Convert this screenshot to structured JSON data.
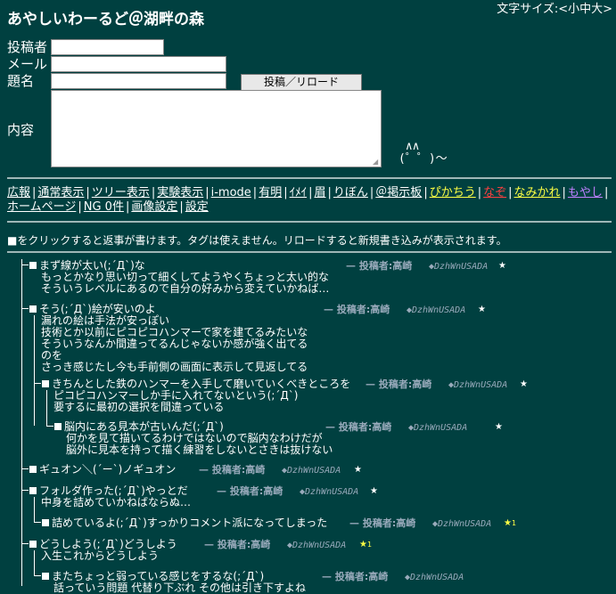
{
  "header": {
    "title": "あやしいわーるど＠湖畔の森",
    "font_size_label": "文字サイズ:<小中大>"
  },
  "form": {
    "name_label": "投稿者",
    "mail_label": "メール",
    "subject_label": "題名",
    "content_label": "内容",
    "submit_label": "投稿／リロード",
    "ascii_art": " ∧∧\n(゜゜)～"
  },
  "nav": [
    {
      "label": "広報",
      "color": "#ffffff"
    },
    {
      "label": "通常表示",
      "color": "#ffffff"
    },
    {
      "label": "ツリー表示",
      "color": "#ffffff"
    },
    {
      "label": "実験表示",
      "color": "#ffffff"
    },
    {
      "label": "i-mode",
      "color": "#ffffff"
    },
    {
      "label": "有明",
      "color": "#ffffff"
    },
    {
      "label": "ｲﾒｲ",
      "color": "#ffffff"
    },
    {
      "label": "眉",
      "color": "#ffffff"
    },
    {
      "label": "りぼん",
      "color": "#ffffff"
    },
    {
      "label": "＠掲示板",
      "color": "#ffffff"
    },
    {
      "label": "ぴかちう",
      "color": "#ffff44"
    },
    {
      "label": "なぞ",
      "color": "#ff4040"
    },
    {
      "label": "なみかれ",
      "color": "#ffff44"
    },
    {
      "label": "もやし",
      "color": "#c080ff"
    },
    {
      "label": "ホームページ",
      "color": "#ffffff"
    },
    {
      "label": "NG 0件",
      "color": "#ffffff"
    },
    {
      "label": "画像設定",
      "color": "#ffffff"
    },
    {
      "label": "設定",
      "color": "#ffffff"
    }
  ],
  "note": "■をクリックすると返事が書けます。タグは使えません。リロードすると新規書き込みが表示されます。",
  "posts": [
    {
      "lines": [
        "まず線が太い(;´Д`)な",
        "もっとかなり思い切って細くしてようやくちょっと太い的な",
        "そういうレベルにあるので自分の好みから変えていかねば…"
      ],
      "meta": "— 投稿者:高崎",
      "trip": "◆DzhWnUSADA",
      "star": "★",
      "star_count": ""
    },
    {
      "lines": [
        "そう(;´Д`)絵が安いのよ",
        "漏れの絵は手法が安っぽい",
        "技術とか以前にピコピコハンマーで家を建てるみたいな",
        "そういうなんか間違ってるんじゃないか感が強く出てる",
        "のを",
        "さっき感じたし今も手前側の画面に表示して見返してる"
      ],
      "meta": "— 投稿者:高崎",
      "trip": "◆DzhWnUSADA",
      "star": "★",
      "star_count": ""
    },
    {
      "lines": [
        "きちんとした鉄のハンマーを入手して磨いていくべきところを",
        "ピコピコハンマーしか手に入れてないという(;´Д`)",
        "要するに最初の選択を間違っている"
      ],
      "meta": "— 投稿者:高崎",
      "trip": "◆DzhWnUSADA",
      "star": "★",
      "star_count": ""
    },
    {
      "lines": [
        "脳内にある見本が古いんだ(;´Д`)",
        "何かを見て描いてるわけではないので脳内なわけだが",
        "脳外に見本を持って描く練習をしないとさきは抜けない"
      ],
      "meta": "— 投稿者:高崎",
      "trip": "◆DzhWnUSADA",
      "star": "★",
      "star_count": ""
    },
    {
      "lines": [
        "ギュオン＼(´ー`)ノギュオン"
      ],
      "meta": "— 投稿者:高崎",
      "trip": "◆DzhWnUSADA",
      "star": "★",
      "star_count": ""
    },
    {
      "lines": [
        "フォルダ作った(;´Д`)やっとだ",
        "中身を詰めていかねばならぬ…"
      ],
      "meta": "— 投稿者:高崎",
      "trip": "◆DzhWnUSADA",
      "star": "★",
      "star_count": ""
    },
    {
      "lines": [
        "詰めているよ(;´Д`)すっかりコメント派になってしまった"
      ],
      "meta": "— 投稿者:高崎",
      "trip": "◆DzhWnUSADA",
      "star": "★",
      "star_count": "1"
    },
    {
      "lines": [
        "どうしよう(;´Д`)どうしよう",
        "入生これからどうしよう"
      ],
      "meta": "— 投稿者:高崎",
      "trip": "◆DzhWnUSADA",
      "star": "★",
      "star_count": "1"
    },
    {
      "lines": [
        "またちょっと弱っている感じをするな(;´Д`)",
        "話っていう問題 代替り下ぶれ その他は引き下すよね"
      ],
      "meta": "— 投稿者:高崎",
      "trip": "◆DzhWnUSADA",
      "star": "",
      "star_count": ""
    }
  ]
}
